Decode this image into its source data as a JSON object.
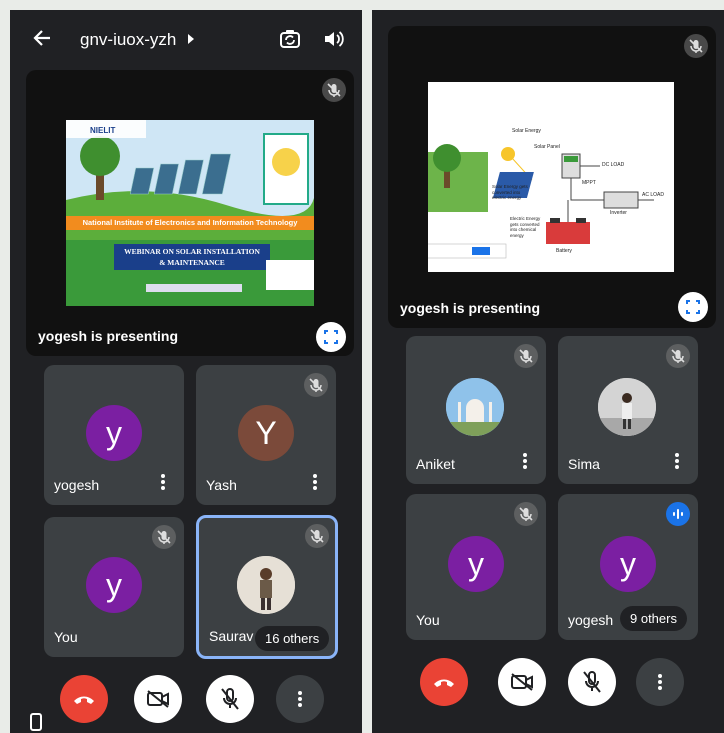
{
  "left": {
    "meeting_code": "gnv-iuox-yzh",
    "presenting_label": "yogesh is presenting",
    "slide": {
      "org_name": "National Institute of Electronics and Information Technology",
      "webinar_title_line1": "WEBINAR ON SOLAR INSTALLATION",
      "webinar_title_line2": "& MAINTENANCE",
      "logo_text": "NIELIT"
    },
    "tiles": [
      {
        "name": "yogesh",
        "initial": "y",
        "color": "#7b1fa2"
      },
      {
        "name": "Yash",
        "initial": "Y",
        "color": "#7b4a3a"
      },
      {
        "name": "You",
        "initial": "y",
        "color": "#7b1fa2"
      },
      {
        "name": "Saurav",
        "others": "16 others"
      }
    ]
  },
  "right": {
    "presenting_label": "yogesh is presenting",
    "diagram": {
      "solar_energy": "Solar Energy",
      "solar_panel": "Solar Panel",
      "dc_load": "DC LOAD",
      "mppt": "MPPT",
      "ac_load": "AC LOAD",
      "inverter": "Inverter",
      "battery": "Battery",
      "note1": "Solar Energy gets converted into electric energy",
      "note2": "Electric Energy gets converted into chemical energy"
    },
    "tiles": [
      {
        "name": "Aniket"
      },
      {
        "name": "Sima"
      },
      {
        "name": "You",
        "initial": "y",
        "color": "#7b1fa2"
      },
      {
        "name": "yogesh",
        "initial": "y",
        "color": "#7b1fa2",
        "others": "9 others"
      }
    ]
  },
  "colors": {
    "end_call": "#ea4335",
    "active_border": "#8ab4f8",
    "tile_bg": "#3c4043",
    "app_bg": "#202124",
    "speaking": "#1a73e8"
  }
}
